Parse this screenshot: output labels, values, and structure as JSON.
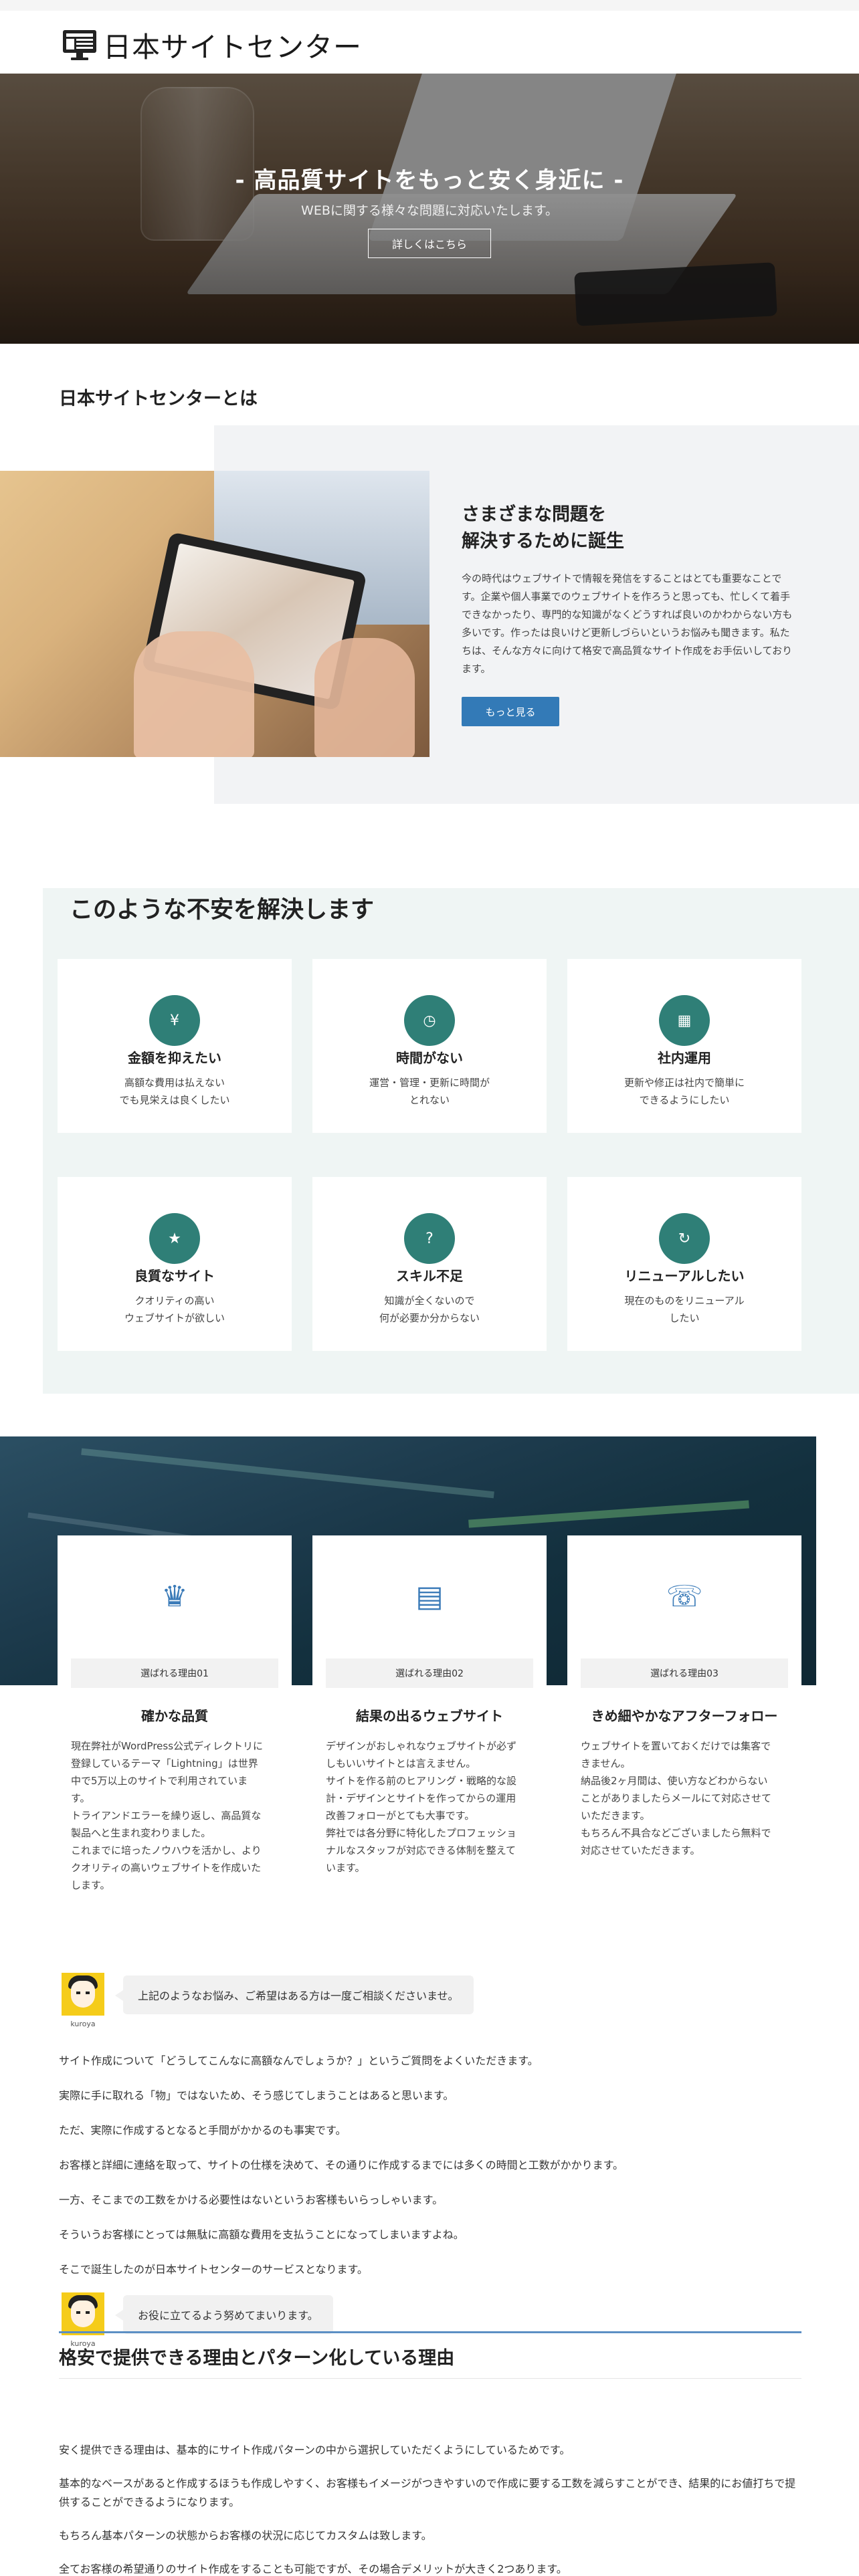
{
  "header": {
    "logo_text": "日本サイトセンター",
    "logo_icon": "monitor-icon"
  },
  "hero": {
    "title": "- 高品質サイトをもっと安く身近に -",
    "subtitle": "WEBに関する様々な問題に対応いたします。",
    "button": "詳しくはこちら"
  },
  "about": {
    "section_title": "日本サイトセンターとは",
    "heading_line1": "さまざまな問題を",
    "heading_line2": "解決するために誕生",
    "text": "今の時代はウェブサイトで情報を発信をすることはとても重要なことです。企業や個人事業でのウェブサイトを作ろうと思っても、忙しくて着手できなかったり、専門的な知識がなくどうすれば良いのかわからない方も多いです。作ったは良いけど更新しづらいというお悩みも聞きます。私たちは、そんな方々に向けて格安で高品質なサイト作成をお手伝いしております。",
    "button": "もっと見る"
  },
  "worries": {
    "title": "このような不安を解決します",
    "items": [
      {
        "title": "金額を抑えたい",
        "desc1": "高額な費用は払えない",
        "desc2": "でも見栄えは良くしたい",
        "icon": "yen-icon"
      },
      {
        "title": "時間がない",
        "desc1": "運営・管理・更新に時間が",
        "desc2": "とれない",
        "icon": "clock-icon"
      },
      {
        "title": "社内運用",
        "desc1": "更新や修正は社内で簡単に",
        "desc2": "できるようにしたい",
        "icon": "building-icon"
      },
      {
        "title": "良質なサイト",
        "desc1": "クオリティの高い",
        "desc2": "ウェブサイトが欲しい",
        "icon": "star-icon"
      },
      {
        "title": "スキル不足",
        "desc1": "知識が全くないので",
        "desc2": "何が必要か分からない",
        "icon": "question-icon"
      },
      {
        "title": "リニューアルしたい",
        "desc1": "現在のものをリニューアル",
        "desc2": "したい",
        "icon": "refresh-icon"
      }
    ]
  },
  "reasons": [
    {
      "tag": "選ばれる理由01",
      "title": "確かな品質",
      "icon": "award-icon",
      "text": "現在弊社がWordPress公式ディレクトリに\n登録しているテーマ「Lightning」は世界\n中で5万以上のサイトで利用されていま\nす。\nトライアンドエラーを繰り返し、高品質な\n製品へと生まれ変わりました。\nこれまでに培ったノウハウを活かし、より\nクオリティの高いウェブサイトを作成いた\nします。"
    },
    {
      "tag": "選ばれる理由02",
      "title": "結果の出るウェブサイト",
      "icon": "chart-icon",
      "text": "デザインがおしゃれなウェブサイトが必ず\nしもいいサイトとは言えません。\nサイトを作る前のヒアリング・戦略的な設\n計・デザインとサイトを作ってからの運用\n改善フォローがとても大事です。\n弊社では各分野に特化したプロフェッショ\nナルなスタッフが対応できる体制を整えて\nいます。"
    },
    {
      "tag": "選ばれる理由03",
      "title": "きめ細やかなアフターフォロー",
      "icon": "support-icon",
      "text": "ウェブサイトを置いておくだけでは集客で\nきません。\n納品後2ヶ月間は、使い方などわからない\nことがありましたらメールにて対応させて\nいただきます。\nもちろん不具合などございましたら無料で\n対応させていただきます。"
    }
  ],
  "talk": {
    "avatar_name": "kuroya",
    "balloon1": "上記のようなお悩み、ご希望はある方は一度ご相談くださいませ。",
    "paragraphs": [
      "サイト作成について「どうしてこんなに高額なんでしょうか？」というご質問をよくいただきます。",
      "実際に手に取れる「物」ではないため、そう感じてしまうことはあると思います。",
      "ただ、実際に作成するとなると手間がかかるのも事実です。",
      "お客様と詳細に連絡を取って、サイトの仕様を決めて、その通りに作成するまでには多くの時間と工数がかかります。",
      "一方、そこまでの工数をかける必要性はないというお客様もいらっしゃいます。",
      "そういうお客様にとっては無駄に高額な費用を支払うことになってしまいますよね。",
      "そこで誕生したのが日本サイトセンターのサービスとなります。"
    ],
    "balloon2": "お役に立てるよう努めてまいります。"
  },
  "section2": {
    "title": "格安で提供できる理由とパターン化している理由",
    "paragraphs": [
      "安く提供できる理由は、基本的にサイト作成パターンの中から選択していただくようにしているためです。",
      "基本的なベースがあると作成するほうも作成しやすく、お客様もイメージがつきやすいので作成に要する工数を減らすことができ、結果的にお値打ちで提供することができるようになります。",
      "もちろん基本パターンの状態からお客様の状況に応じてカスタムは致します。",
      "全てお客様の希望通りのサイト作成をすることも可能ですが、その場合デメリットが大きく2つあります。"
    ]
  }
}
